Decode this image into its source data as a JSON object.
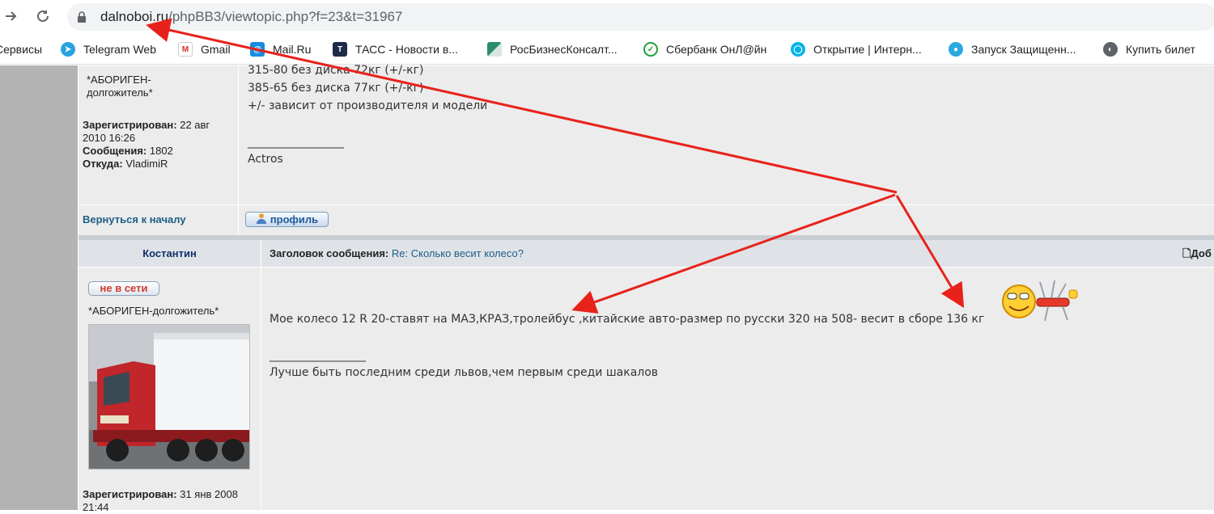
{
  "browser": {
    "url_domain": "dalnoboi.ru",
    "url_path": "/phpBB3/viewtopic.php?f=23&t=31967"
  },
  "bookmarks": [
    {
      "label": "Сервисы",
      "icon": "apps-icon"
    },
    {
      "label": "Telegram Web",
      "icon": "telegram-icon"
    },
    {
      "label": "Gmail",
      "icon": "gmail-icon"
    },
    {
      "label": "Mail.Ru",
      "icon": "mailru-icon"
    },
    {
      "label": "ТАСС - Новости в...",
      "icon": "tass-icon"
    },
    {
      "label": "РосБизнесКонсалт...",
      "icon": "rbc-icon"
    },
    {
      "label": "Сбербанк ОнЛ@йн",
      "icon": "sberbank-icon"
    },
    {
      "label": "Открытие | Интерн...",
      "icon": "otkritie-icon"
    },
    {
      "label": "Запуск Защищенн...",
      "icon": "secure-launch-icon"
    },
    {
      "label": "Купить билет",
      "icon": "globe-icon"
    }
  ],
  "post1": {
    "rank": "*АБОРИГЕН-\nдолгожитель*",
    "registered_label": "Зарегистрирован:",
    "registered_value": "22 авг 2010 16:26",
    "messages_label": "Сообщения:",
    "messages_value": "1802",
    "from_label": "Откуда:",
    "from_value": "VladimiR",
    "lines": [
      "315-80 без диска 72кг (+/-кг)",
      "385-65 без диска 77кг (+/-кг)",
      "+/- зависит от производителя и модели"
    ],
    "signature_rule": "_________________",
    "signature": "Actros",
    "back_to_top": "Вернуться к началу",
    "profile_button": "профиль"
  },
  "post2": {
    "author": "Костантин",
    "subject_label": "Заголовок сообщения:",
    "subject_prefix": "Re:",
    "subject_value": "Сколько весит колесо?",
    "add_label": "Доб",
    "status": "не в сети",
    "rank": "*АБОРИГЕН-долгожитель*",
    "message": "Мое колесо 12 R 20-ставят на МАЗ,КРАЗ,тролейбус ,китайские авто-размер по русски 320 на 508- весит в сборе 136 кг",
    "signature_rule": "_________________",
    "signature": "Лучше быть последним среди львов,чем первым среди шакалов",
    "registered_label": "Зарегистрирован:",
    "registered_value": "31 янв 2008",
    "registered_time": "21:44"
  },
  "colors": {
    "annotation_arrow": "#e8221b",
    "link": "#1f5e86",
    "offline": "#d23b2e"
  }
}
